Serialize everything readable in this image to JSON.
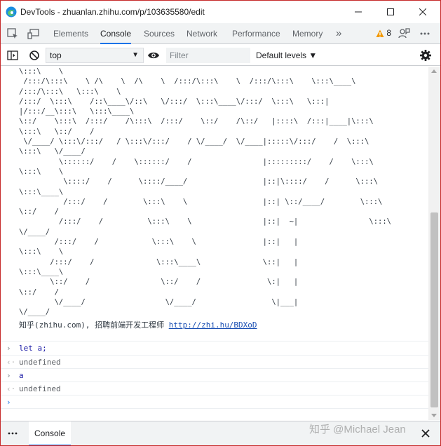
{
  "window": {
    "title": "DevTools - zhuanlan.zhihu.com/p/103635580/edit"
  },
  "tabs": [
    {
      "label": "Elements"
    },
    {
      "label": "Console"
    },
    {
      "label": "Sources"
    },
    {
      "label": "Network"
    },
    {
      "label": "Performance"
    },
    {
      "label": "Memory"
    }
  ],
  "more_tabs_glyph": "»",
  "warnings": {
    "count": "8"
  },
  "toolbar": {
    "context": "top",
    "filter_placeholder": "Filter",
    "levels_label": "Default levels ▼"
  },
  "console": {
    "ascii_art": [
      "\\:::\\    \\",
      " /:::/\\:::\\    \\ /\\    \\  /\\    \\  /:::/\\:::\\    \\  /:::/\\:::\\    \\:::\\____\\",
      "/:::/\\:::\\   \\:::\\    \\",
      "/:::/  \\:::\\    /::\\____\\/::\\   \\/:::/  \\:::\\____\\/:::/  \\:::\\   \\:::|",
      "|/:::/__\\:::\\   \\:::\\____\\",
      "\\::/    \\:::\\  /:::/    /\\:::\\  /:::/    \\::/    /\\::/   |::::\\  /:::|____|\\:::\\",
      "\\:::\\   \\::/    /",
      " \\/____/ \\:::\\/:::/   / \\:::\\/:::/    / \\/____/  \\/____|:::::\\/:::/    /  \\:::\\",
      "\\:::\\   \\/____/",
      "         \\::::::/    /    \\::::::/    /                |:::::::::/    /    \\:::\\",
      "\\:::\\    \\",
      "          \\::::/    /      \\::::/____/                 |::|\\::::/    /      \\:::\\",
      "\\:::\\____\\",
      "          /:::/    /        \\:::\\    \\                 |::| \\::/____/        \\:::\\",
      "\\::/    /",
      "         /:::/    /          \\:::\\    \\                |::|  ~|                \\:::\\",
      "\\/____/",
      "        /:::/    /            \\:::\\    \\               |::|   |",
      "\\:::\\    \\",
      "       /:::/    /              \\:::\\____\\              \\::|   |",
      "\\:::\\____\\",
      "       \\::/    /                \\::/    /               \\:|   |",
      "\\::/    /",
      "        \\/____/                  \\/____/                 \\|___|",
      "\\/____/"
    ],
    "signature_text": "知乎(zhihu.com), 招聘前端开发工程师 ",
    "signature_link": "http://zhi.hu/BDXoD",
    "entries": [
      {
        "glyph": "›",
        "text": "let a;"
      },
      {
        "glyph": "‹·",
        "text": "undefined"
      },
      {
        "glyph": "›",
        "text": "a"
      },
      {
        "glyph": "‹·",
        "text": "undefined"
      }
    ],
    "prompt_glyph": "›"
  },
  "drawer": {
    "menu_glyph": "⋮",
    "tab_label": "Console"
  },
  "watermark": "知乎 @Michael Jean",
  "colors": {
    "accent": "#1a73e8",
    "warning": "#f29900",
    "window_border": "#c62a2a"
  },
  "icons": [
    "edge-icon",
    "inspect-element-icon",
    "device-toolbar-icon",
    "warning-icon",
    "feedback-icon",
    "more-options-icon",
    "sidebar-toggle-icon",
    "clear-console-icon",
    "live-expression-eye-icon",
    "settings-gear-icon",
    "close-icon"
  ]
}
